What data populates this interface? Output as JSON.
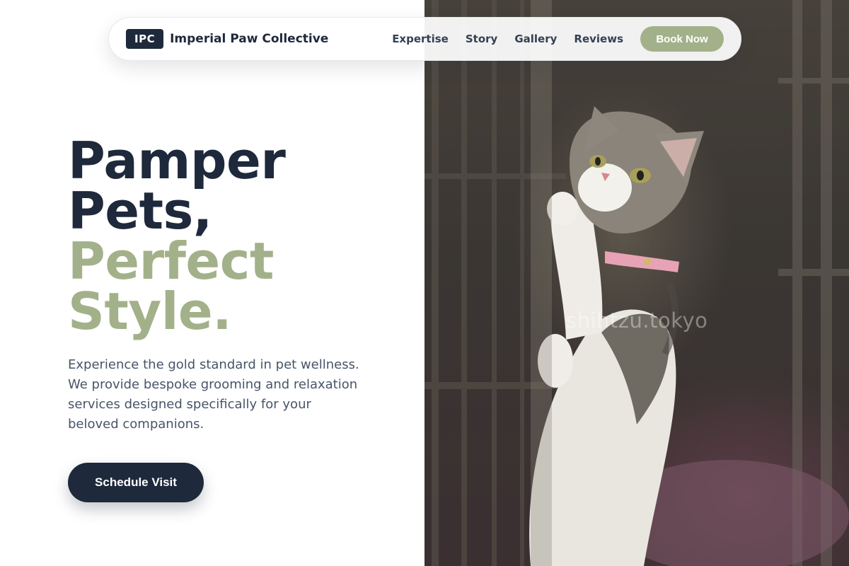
{
  "nav": {
    "logo_badge": "IPC",
    "brand_name": "Imperial Paw Collective",
    "links": [
      "Expertise",
      "Story",
      "Gallery",
      "Reviews"
    ],
    "book_label": "Book Now"
  },
  "hero": {
    "headline_dark": [
      "Pamper",
      "Pets,"
    ],
    "headline_accent": [
      "Perfect",
      "Style."
    ],
    "description": "Experience the gold standard in pet wellness. We provide bespoke grooming and relaxation services designed specifically for your beloved companions.",
    "cta_label": "Schedule Visit"
  },
  "photo": {
    "watermark": "shihtzu.tokyo"
  },
  "colors": {
    "navy": "#1e293b",
    "sage": "#a3b18a",
    "body_text": "#475569"
  }
}
